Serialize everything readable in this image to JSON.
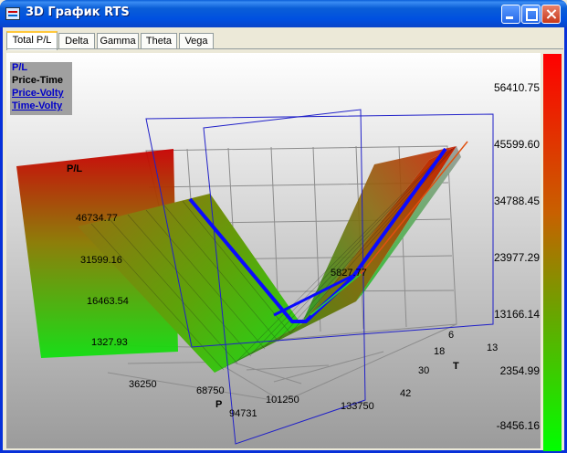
{
  "window": {
    "title": "3D График RTS"
  },
  "tabs": [
    {
      "label": "Total P/L",
      "active": true
    },
    {
      "label": "Delta"
    },
    {
      "label": "Gamma"
    },
    {
      "label": "Theta"
    },
    {
      "label": "Vega"
    }
  ],
  "legend": {
    "items": [
      {
        "label": "P/L",
        "color": "#0000c8"
      },
      {
        "label": "Price-Time",
        "color": "#000000"
      },
      {
        "label": "Price-Volty",
        "color": "#0000c8",
        "underline": true
      },
      {
        "label": "Time-Volty",
        "color": "#0000c8",
        "underline": true
      }
    ]
  },
  "colorbar": {
    "labels": [
      "56410.75",
      "45599.60",
      "34788.45",
      "23977.29",
      "13166.14",
      "2354.99",
      "-8456.16"
    ]
  },
  "axes": {
    "z_label": "P/L",
    "z_ticks": [
      "46734.77",
      "31599.16",
      "16463.54",
      "1327.93"
    ],
    "x_label": "P",
    "x_ticks": [
      "36250",
      "68750",
      "101250",
      "133750"
    ],
    "y_label": "T",
    "y_ticks": [
      "6",
      "13",
      "18",
      "30",
      "42"
    ],
    "cursor_price": "94731",
    "cursor_value": "5827.77"
  },
  "colors": {
    "surface_high": "#ff0000",
    "surface_low": "#00ff00",
    "path": "#0000ff"
  }
}
